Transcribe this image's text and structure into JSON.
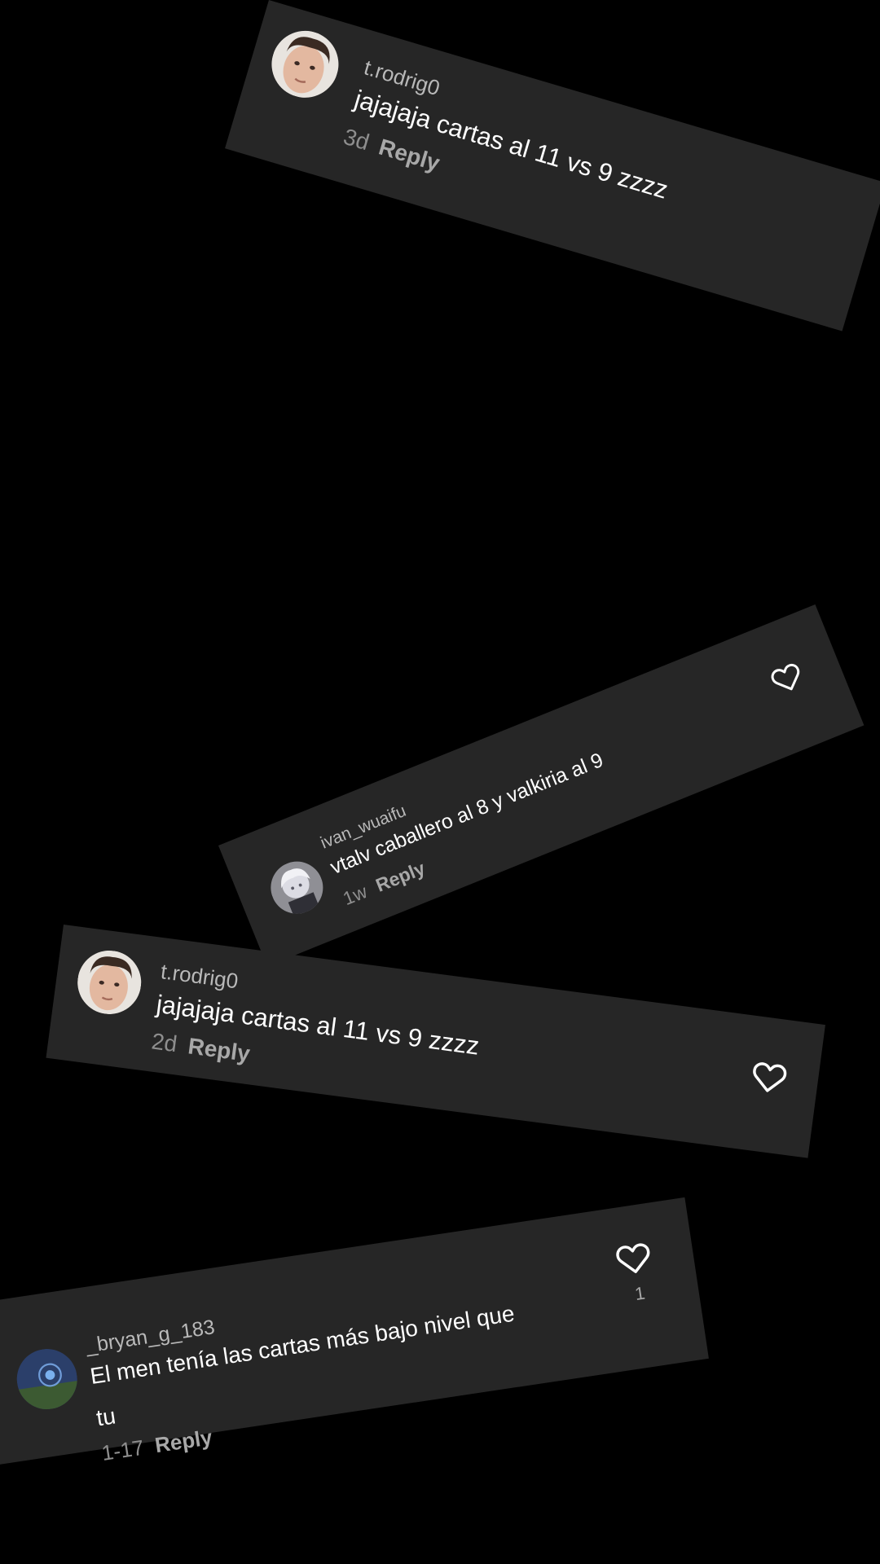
{
  "comments": [
    {
      "username": "t.rodrig0",
      "text": "jajajaja cartas al 11 vs 9 zzzz",
      "time": "3d",
      "reply_label": "Reply"
    },
    {
      "username": "ivan_wuaifu",
      "text": "vtalv caballero al 8 y valkiria al 9",
      "time": "1w",
      "reply_label": "Reply"
    },
    {
      "username": "t.rodrig0",
      "text": "jajajaja cartas al 11 vs 9 zzzz",
      "time": "2d",
      "reply_label": "Reply"
    },
    {
      "username": "_bryan_g_183",
      "text_line1": "El men tenía las cartas más bajo nivel que",
      "text_line2": "tu",
      "time": "1-17",
      "reply_label": "Reply",
      "like_count": "1"
    }
  ],
  "icons": {
    "heart": "heart-outline-icon"
  },
  "colors": {
    "background": "#000000",
    "card": "#262626",
    "username": "#b9b9b9",
    "comment_text": "#ffffff",
    "meta": "#8e8e8e"
  }
}
